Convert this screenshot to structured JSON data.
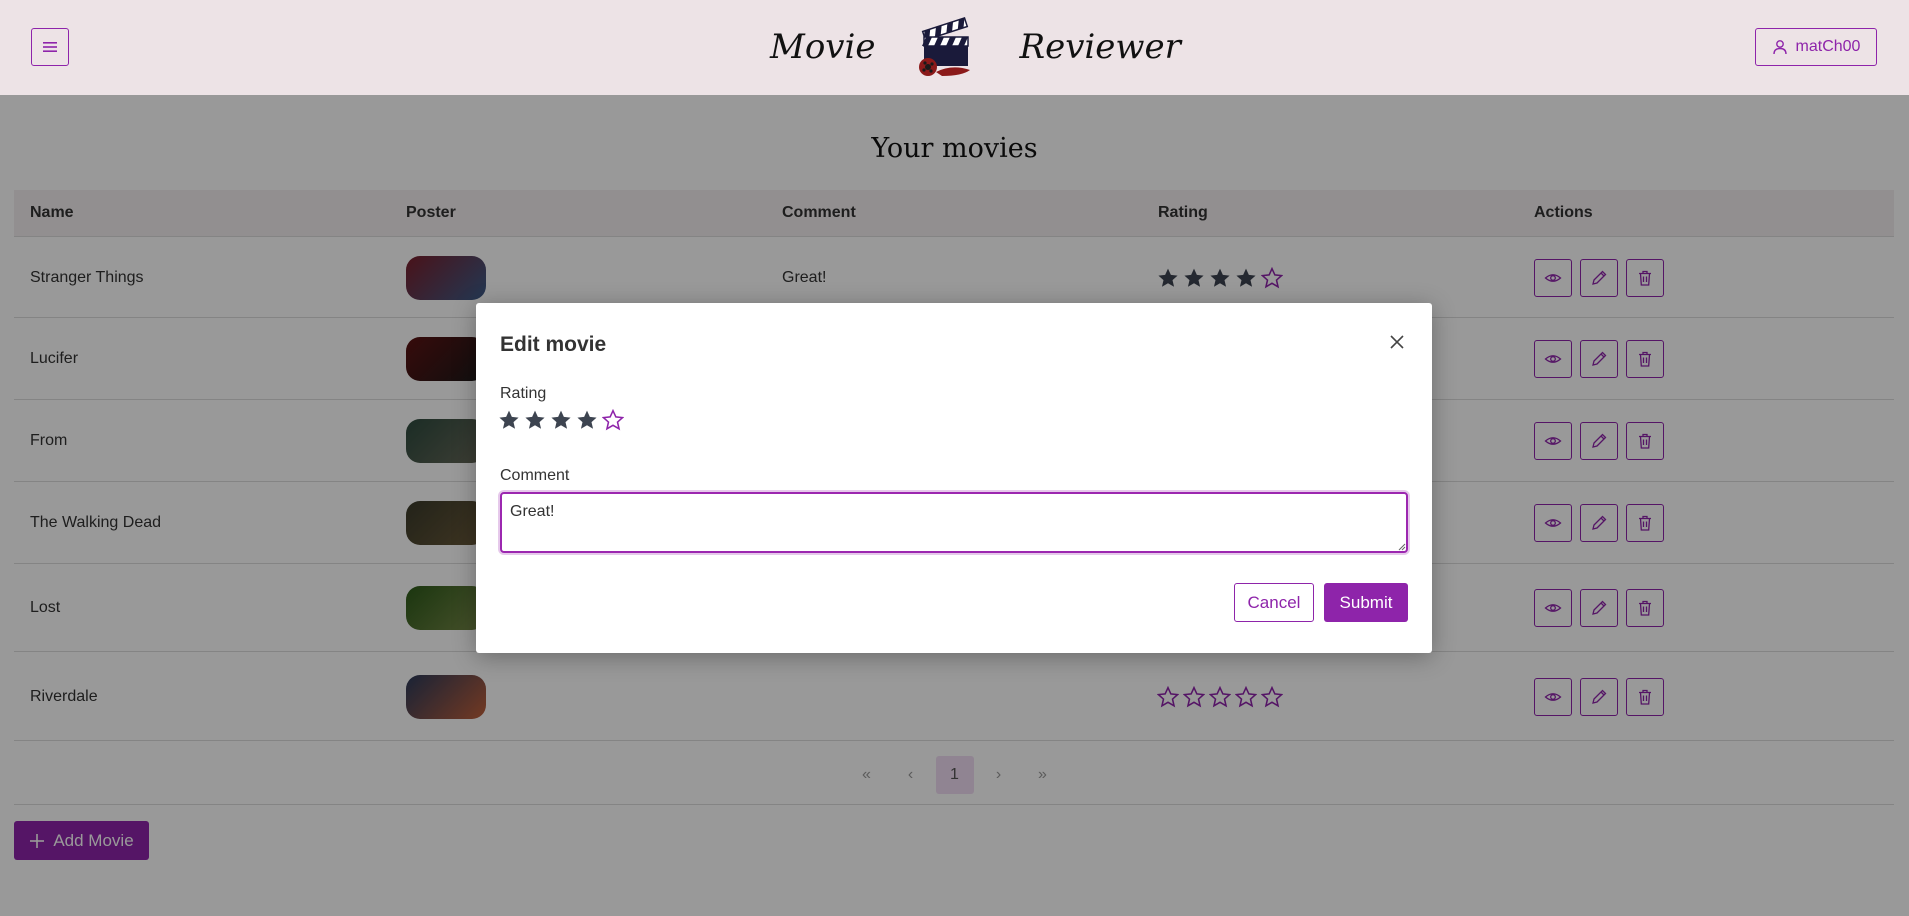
{
  "header": {
    "brand_left": "Movie",
    "brand_right": "Reviewer",
    "user_name": "matCh00"
  },
  "page_title": "Your movies",
  "table": {
    "columns": [
      "Name",
      "Poster",
      "Comment",
      "Rating",
      "Actions"
    ],
    "rows": [
      {
        "name": "Stranger Things",
        "comment": "Great!",
        "rating": 4,
        "poster_colors": [
          "#7a1f2b",
          "#3b5d8a"
        ]
      },
      {
        "name": "Lucifer",
        "comment": "",
        "rating": null,
        "poster_colors": [
          "#5b1212",
          "#1a1a1a"
        ]
      },
      {
        "name": "From",
        "comment": "",
        "rating": null,
        "poster_colors": [
          "#2d4a3e",
          "#6a6a5a"
        ]
      },
      {
        "name": "The Walking Dead",
        "comment": "",
        "rating": null,
        "poster_colors": [
          "#3a3a2a",
          "#6b5a3a"
        ]
      },
      {
        "name": "Lost",
        "comment": "",
        "rating": null,
        "poster_colors": [
          "#2d5a1a",
          "#7a8a4a"
        ]
      },
      {
        "name": "Riverdale",
        "comment": "",
        "rating": 0,
        "poster_colors": [
          "#2a3a5a",
          "#c0603a"
        ]
      }
    ]
  },
  "pagination": {
    "first": "«",
    "prev": "‹",
    "current": "1",
    "next": "›",
    "last": "»"
  },
  "add_button_label": "Add Movie",
  "modal": {
    "title": "Edit movie",
    "rating_label": "Rating",
    "rating_value": 4,
    "rating_max": 5,
    "comment_label": "Comment",
    "comment_value": "Great!",
    "cancel_label": "Cancel",
    "submit_label": "Submit"
  },
  "colors": {
    "accent": "#8e24aa",
    "header_bg": "#ede3e6",
    "star_filled": "#3d4450"
  },
  "icons": {
    "menu": "hamburger-icon",
    "user": "user-icon",
    "view": "eye-icon",
    "edit": "pencil-icon",
    "delete": "trash-icon",
    "close": "close-icon",
    "add": "plus-icon"
  }
}
